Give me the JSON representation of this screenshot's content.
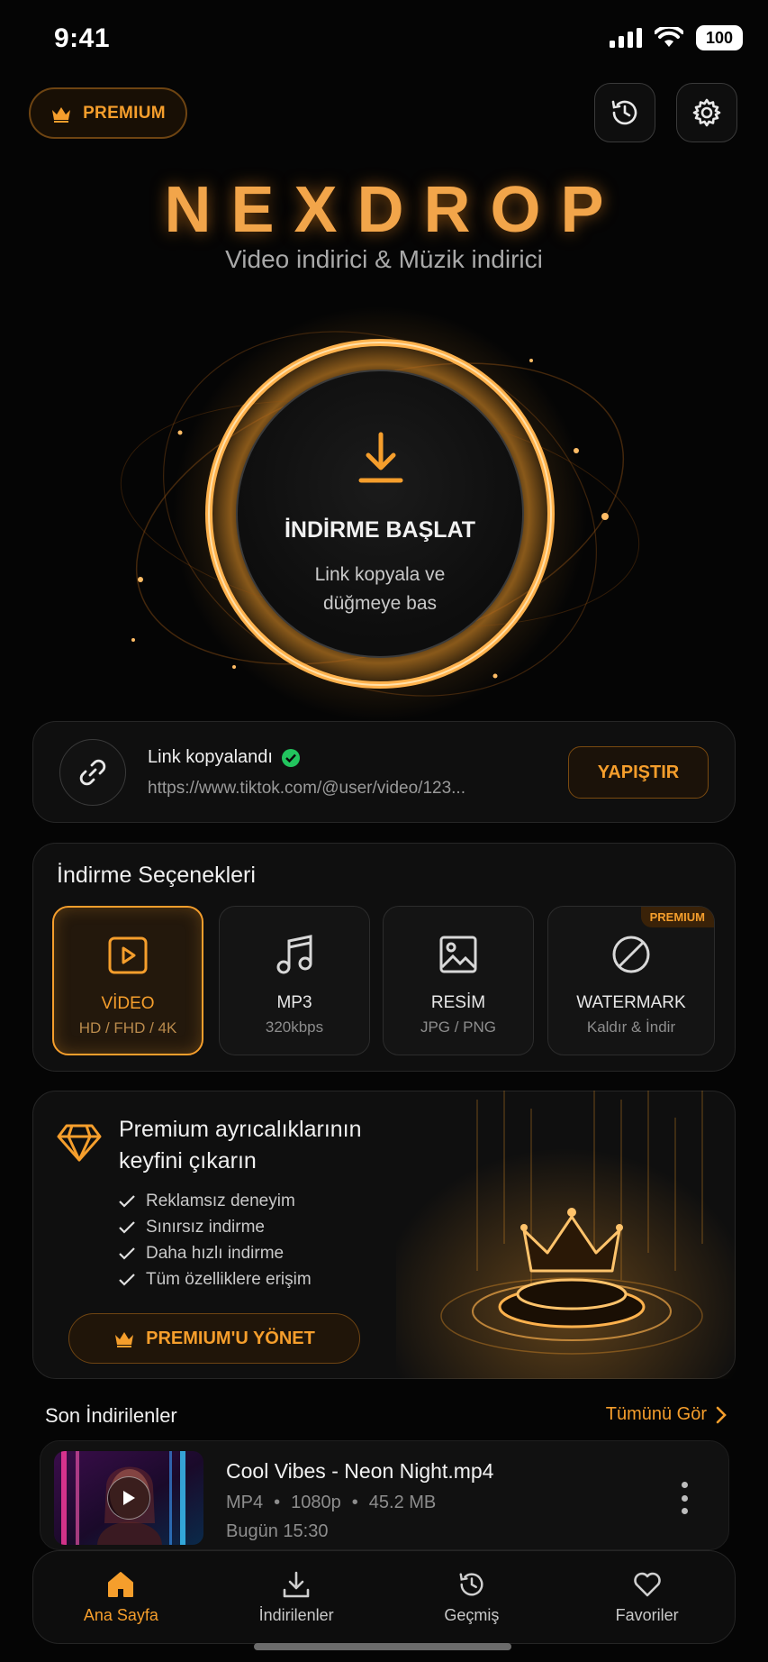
{
  "status": {
    "time": "9:41",
    "battery": "100"
  },
  "header": {
    "premium_label": "PREMIUM"
  },
  "brand": {
    "logo": "NEXDROP",
    "subtitle": "Video indirici & Müzik indirici"
  },
  "hero": {
    "title": "İNDİRME BAŞLAT",
    "subtitle_line1": "Link kopyala ve",
    "subtitle_line2": "düğmeye bas"
  },
  "link": {
    "title": "Link kopyalandı",
    "url": "https://www.tiktok.com/@user/video/123...",
    "paste_label": "YAPIŞTIR"
  },
  "options": {
    "title": "İndirme Seçenekleri",
    "items": [
      {
        "label": "VİDEO",
        "sub": "HD / FHD / 4K",
        "icon": "video-play-icon",
        "active": true
      },
      {
        "label": "MP3",
        "sub": "320kbps",
        "icon": "music-note-icon",
        "active": false
      },
      {
        "label": "RESİM",
        "sub": "JPG / PNG",
        "icon": "image-icon",
        "active": false
      },
      {
        "label": "WATERMARK",
        "sub": "Kaldır & İndir",
        "icon": "no-watermark-icon",
        "active": false,
        "badge": "PREMIUM"
      }
    ]
  },
  "promo": {
    "title": "Premium ayrıcalıklarının keyfini çıkarın",
    "benefits": [
      "Reklamsız deneyim",
      "Sınırsız indirme",
      "Daha hızlı indirme",
      "Tüm özelliklere erişim"
    ],
    "manage_label": "PREMIUM'U YÖNET"
  },
  "recent": {
    "title": "Son İndirilenler",
    "see_all": "Tümünü Gör",
    "items": [
      {
        "name": "Cool Vibes - Neon Night.mp4",
        "format": "MP4",
        "resolution": "1080p",
        "size": "45.2 MB",
        "time": "Bugün 15:30"
      }
    ]
  },
  "tabs": [
    {
      "label": "Ana Sayfa",
      "icon": "home-icon",
      "active": true
    },
    {
      "label": "İndirilenler",
      "icon": "download-icon",
      "active": false
    },
    {
      "label": "Geçmiş",
      "icon": "history-icon",
      "active": false
    },
    {
      "label": "Favoriler",
      "icon": "heart-icon",
      "active": false
    }
  ],
  "colors": {
    "accent": "#f59e2c",
    "background": "#050505",
    "card": "#0f0f0f",
    "success": "#22c55e"
  }
}
